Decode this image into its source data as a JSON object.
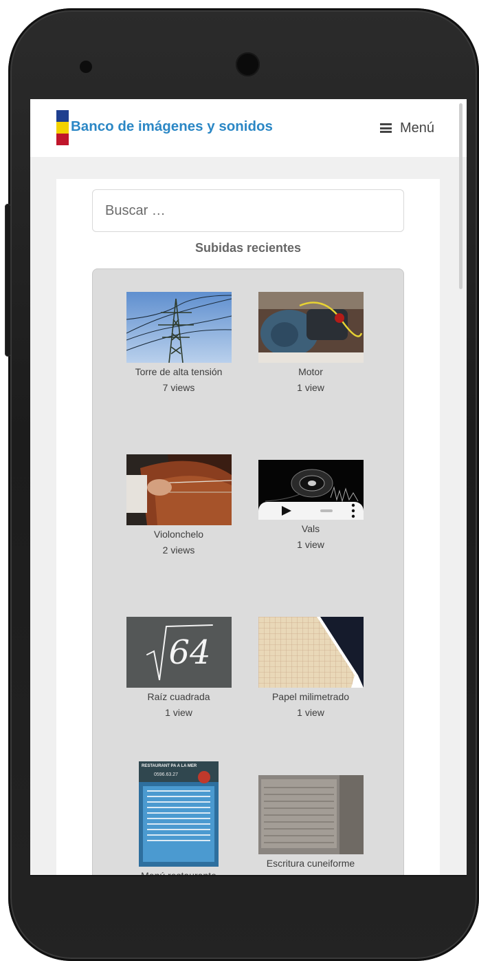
{
  "header": {
    "site_title": "Banco de imágenes y sonidos",
    "menu_label": "Menú"
  },
  "search": {
    "placeholder": "Buscar …"
  },
  "recent": {
    "title": "Subidas recientes",
    "items": [
      {
        "caption": "Torre de alta tensión",
        "views": "7 views",
        "kind": "image"
      },
      {
        "caption": "Motor",
        "views": "1 view",
        "kind": "image"
      },
      {
        "caption": "Violonchelo",
        "views": "2 views",
        "kind": "image"
      },
      {
        "caption": "Vals",
        "views": "1 view",
        "kind": "audio"
      },
      {
        "caption": "Raíz cuadrada",
        "views": "1 view",
        "kind": "image"
      },
      {
        "caption": "Papel milimetrado",
        "views": "1 view",
        "kind": "image"
      },
      {
        "caption": "Menú restaurante",
        "views": "",
        "kind": "image"
      },
      {
        "caption": "Escritura cuneiforme",
        "views": "",
        "kind": "image"
      }
    ],
    "sqrt_text": "64",
    "restaurant_sign": "RESTAURANT PA A LA MER",
    "restaurant_phone": "0596.63.27"
  },
  "colors": {
    "title_blue": "#2b87c5",
    "gallery_bg": "#dcdcdc"
  }
}
